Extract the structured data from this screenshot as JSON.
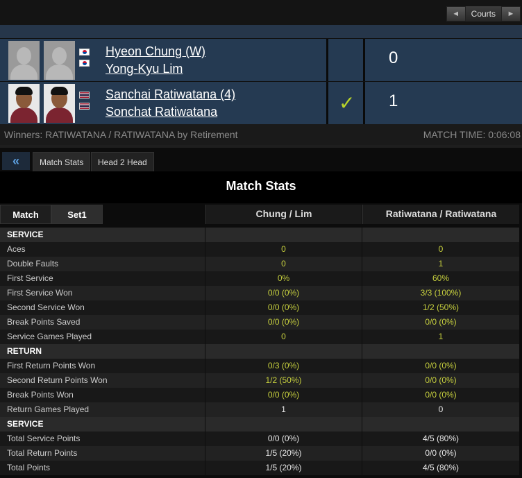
{
  "nav": {
    "courts_label": "Courts",
    "prev_icon": "◄",
    "next_icon": "►"
  },
  "teams": [
    {
      "players": [
        "Hyeon Chung (W)",
        "Yong-Kyu Lim"
      ],
      "flags": [
        "kr",
        "kr"
      ],
      "winner": false,
      "score": "0"
    },
    {
      "players": [
        "Sanchai Ratiwatana (4)",
        "Sonchat Ratiwatana"
      ],
      "flags": [
        "th",
        "th"
      ],
      "winner": true,
      "winner_mark": "✓",
      "score": "1"
    }
  ],
  "info": {
    "winners_text": "Winners: RATIWATANA / RATIWATANA by Retirement",
    "match_time": "MATCH TIME: 0:06:08"
  },
  "tabs": {
    "back_icon": "«",
    "match_stats": "Match Stats",
    "head2head": "Head 2 Head"
  },
  "stats_title": "Match Stats",
  "set_buttons": {
    "match": "Match",
    "set1": "Set1"
  },
  "columns": [
    "Chung / Lim",
    "Ratiwatana / Ratiwatana"
  ],
  "rows": [
    {
      "type": "section",
      "label": "SERVICE"
    },
    {
      "label": "Aces",
      "v1": "0",
      "v2": "0",
      "hl": true
    },
    {
      "label": "Double Faults",
      "v1": "0",
      "v2": "1",
      "hl": true
    },
    {
      "label": "First Service",
      "v1": "0%",
      "v2": "60%",
      "hl": true
    },
    {
      "label": "First Service Won",
      "v1": "0/0 (0%)",
      "v2": "3/3 (100%)",
      "hl": true
    },
    {
      "label": "Second Service Won",
      "v1": "0/0 (0%)",
      "v2": "1/2 (50%)",
      "hl": true
    },
    {
      "label": "Break Points Saved",
      "v1": "0/0 (0%)",
      "v2": "0/0 (0%)",
      "hl": true
    },
    {
      "label": "Service Games Played",
      "v1": "0",
      "v2": "1",
      "hl": true
    },
    {
      "type": "section",
      "label": "RETURN"
    },
    {
      "label": "First Return Points Won",
      "v1": "0/3 (0%)",
      "v2": "0/0 (0%)",
      "hl": true
    },
    {
      "label": "Second Return Points Won",
      "v1": "1/2 (50%)",
      "v2": "0/0 (0%)",
      "hl": true
    },
    {
      "label": "Break Points Won",
      "v1": "0/0 (0%)",
      "v2": "0/0 (0%)",
      "hl": true
    },
    {
      "label": "Return Games Played",
      "v1": "1",
      "v2": "0",
      "hl": false
    },
    {
      "type": "section",
      "label": "SERVICE"
    },
    {
      "label": "Total Service Points",
      "v1": "0/0 (0%)",
      "v2": "4/5 (80%)",
      "hl": false
    },
    {
      "label": "Total Return Points",
      "v1": "1/5 (20%)",
      "v2": "0/0 (0%)",
      "hl": false
    },
    {
      "label": "Total Points",
      "v1": "1/5 (20%)",
      "v2": "4/5 (80%)",
      "hl": false
    }
  ]
}
